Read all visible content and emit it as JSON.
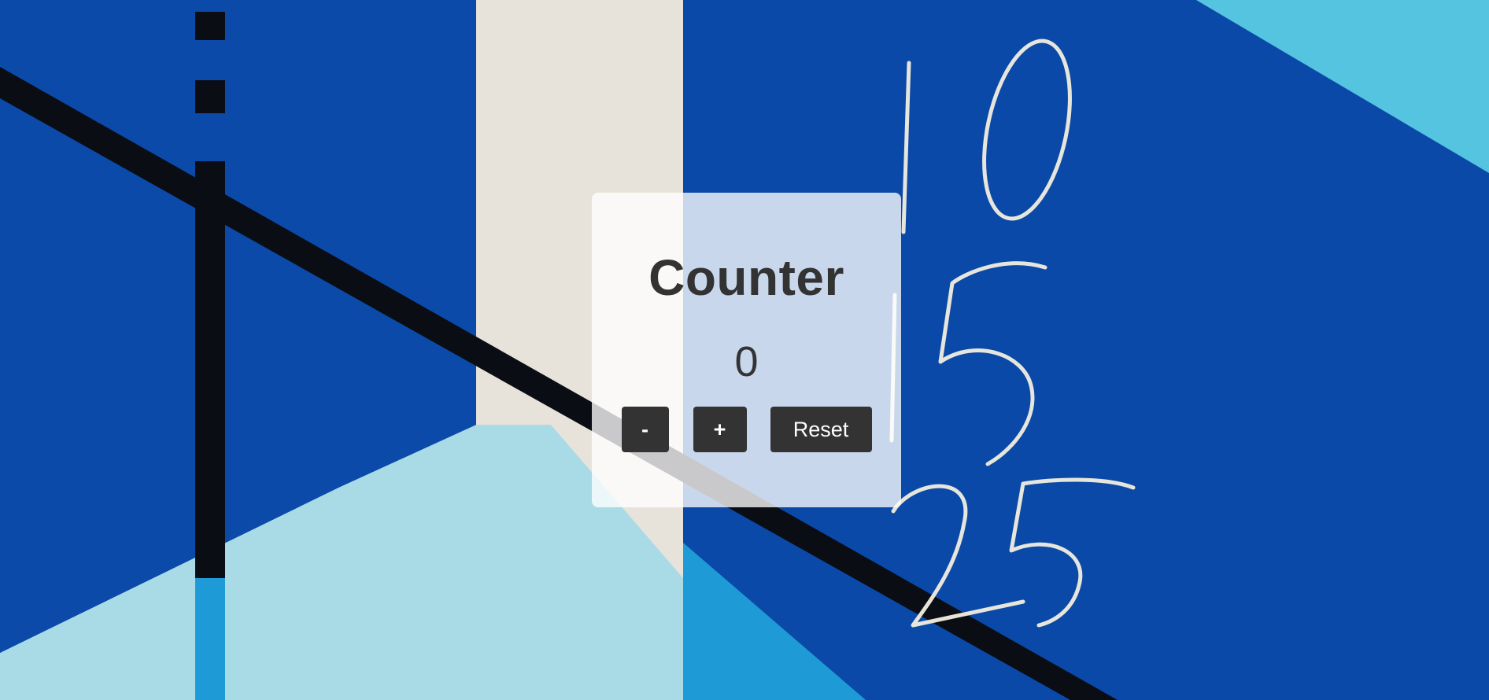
{
  "background": {
    "description_icon": "painted-wall-background",
    "chalk_numbers": [
      "10",
      "15",
      "25"
    ],
    "colors": {
      "deep_blue": "#0a49a8",
      "cyan": "#29a9d8",
      "light_blue": "#a7dce8",
      "concrete": "#e9e4dc",
      "stripe": "#0b0d14",
      "chalk": "#f3efdf"
    }
  },
  "counter": {
    "title": "Counter",
    "value": "0",
    "buttons": {
      "decrement_label": "-",
      "increment_label": "+",
      "reset_label": "Reset"
    },
    "colors": {
      "text": "#333333",
      "button_bg": "#333333",
      "button_text": "#ffffff"
    }
  }
}
